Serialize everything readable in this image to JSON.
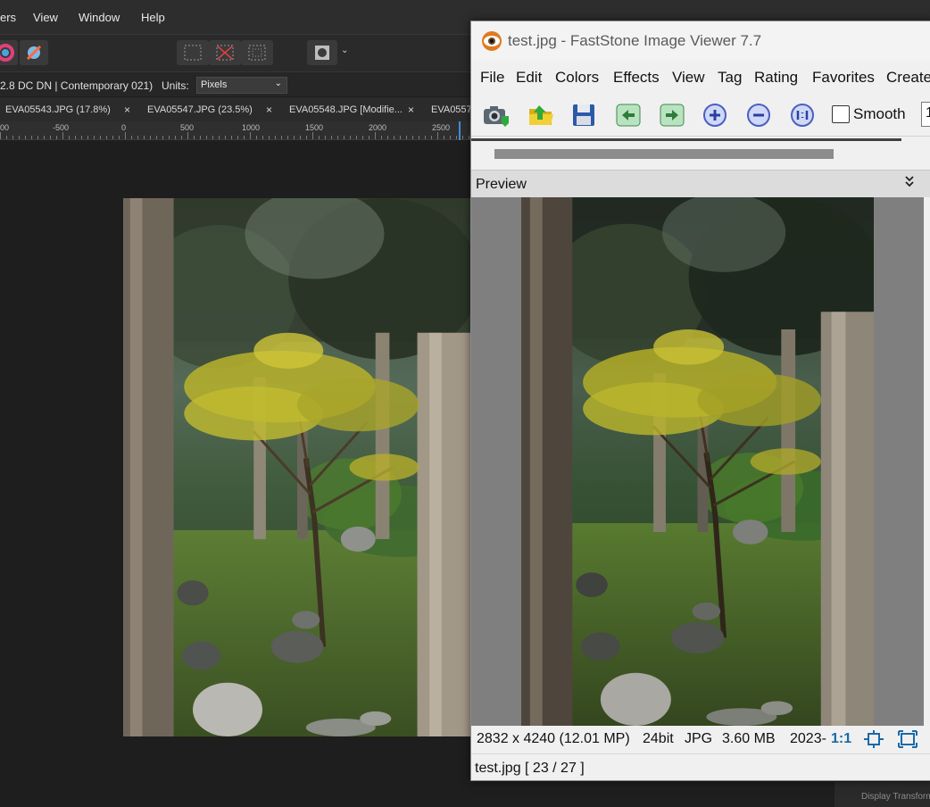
{
  "editor": {
    "menu": [
      "ers",
      "View",
      "Window",
      "Help"
    ],
    "context": {
      "lens": "2.8 DC DN | Contemporary 021)",
      "units_label": "Units:",
      "units_value": "Pixels"
    },
    "tabs": [
      {
        "label": "EVA05543.JPG (17.8%)",
        "close": "×"
      },
      {
        "label": "EVA05547.JPG (23.5%)",
        "close": "×"
      },
      {
        "label": "EVA05548.JPG [Modifie...",
        "close": "×"
      },
      {
        "label": "EVA0557",
        "close": ""
      }
    ],
    "ruler": [
      "00",
      "-500",
      "0",
      "500",
      "1000",
      "1500",
      "2000",
      "2500"
    ],
    "bottom_panel": "Display Transform"
  },
  "viewer": {
    "title": "test.jpg  -  FastStone Image Viewer 7.7",
    "menu": [
      "File",
      "Edit",
      "Colors",
      "Effects",
      "View",
      "Tag",
      "Rating",
      "Favorites",
      "Create"
    ],
    "smooth_label": "Smooth",
    "zoom_value": "1",
    "preview_label": "Preview",
    "preview_toggle": "»",
    "status": {
      "dimensions": "2832 x 4240 (12.01 MP)",
      "bitdepth": "24bit",
      "format": "JPG",
      "size": "3.60 MB",
      "date": "2023-",
      "actual_size": "1:1"
    },
    "file_info": "test.jpg [ 23 / 27 ]"
  },
  "icons": [
    "camera-import-icon",
    "open-folder-icon",
    "save-disk-icon",
    "prev-arrow-icon",
    "next-arrow-icon",
    "zoom-in-icon",
    "zoom-out-icon",
    "fit-icon",
    "fit-window-icon",
    "fullscreen-icon",
    "eye-app-icon"
  ]
}
